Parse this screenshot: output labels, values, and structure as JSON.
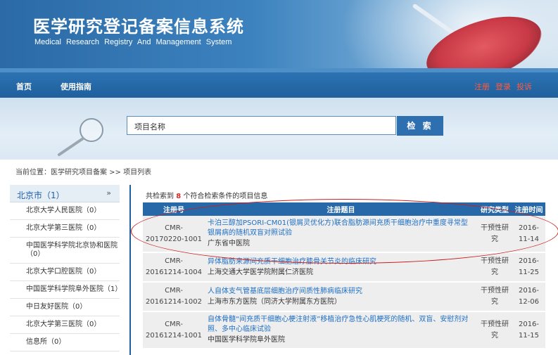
{
  "header": {
    "title": "医学研究登记备案信息系统",
    "subtitle": "Medical Research Registry And Management System"
  },
  "nav": {
    "home": "首页",
    "guide": "使用指南",
    "register": "注册",
    "login": "登录",
    "complaint": "投诉"
  },
  "search": {
    "value": "项目名称",
    "button_label": "检 索"
  },
  "breadcrumb": "当前位置：医学研究项目备案 >> 项目列表",
  "sidebar": {
    "region": "北京市（1）",
    "chevron": "»",
    "items": [
      {
        "label": "北京大学人民医院（0）"
      },
      {
        "label": "北京大学第三医院（0）"
      },
      {
        "label": "中国医学科学院北京协和医院（0）"
      },
      {
        "label": "北京大学口腔医院（0）"
      },
      {
        "label": "中国医学科学院阜外医院（1）"
      },
      {
        "label": "中日友好医院（0）"
      },
      {
        "label": "北京大学第三医院（0）"
      },
      {
        "label": "信息所（0）"
      }
    ]
  },
  "results": {
    "summary_prefix": "共检索到",
    "count": "8",
    "summary_suffix": "个符合检索条件的项目信息",
    "columns": [
      "注册号",
      "注册题目",
      "研究类型",
      "注册时间"
    ],
    "rows": [
      {
        "reg_no": "CMR-20170220-1001",
        "title": "卡泊三醇加PSORI-CM01(银屑灵优化方)联合脂肪源间充质干细胞治疗中重度寻常型银屑病的随机双盲对照试验",
        "hospital": "广东省中医院",
        "type": "干预性研究",
        "date": "2016-11-14"
      },
      {
        "reg_no": "CMR-20161214-1004",
        "title": "异体脂肪来源间充质干细胞治疗膝骨关节炎的临床研究",
        "hospital": "上海交通大学医学院附属仁济医院",
        "type": "干预性研究",
        "date": "2016-11-25"
      },
      {
        "reg_no": "CMR-20161214-1002",
        "title": "人自体支气管基底层细胞治疗间质性肺病临床研究",
        "hospital": "上海市东方医院（同济大学附属东方医院）",
        "type": "干预性研究",
        "date": "2016-12-06"
      },
      {
        "reg_no": "CMR-20161214-1001",
        "title": "自体骨髓“间充质干细胞心梗注射液”移植治疗急性心肌梗死的随机、双盲、安慰剂对照、多中心临床试验",
        "hospital": "中国医学科学院阜外医院",
        "type": "干预性研究",
        "date": "2016-11-15"
      }
    ]
  }
}
